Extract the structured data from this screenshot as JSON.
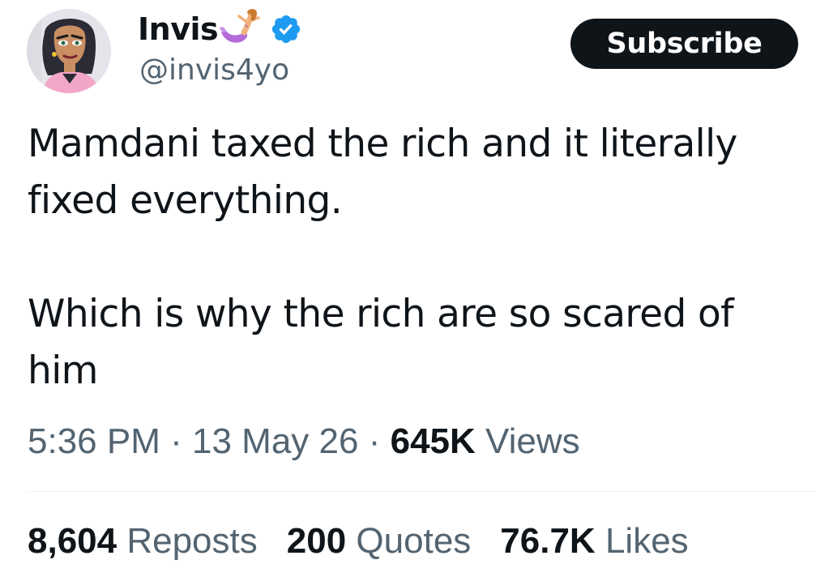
{
  "author": {
    "display_name": "Invis",
    "handle": "@invis4yo",
    "name_emoji": "mermaid-emoji",
    "verified_icon": "verified-badge-icon",
    "verified_color": "#1d9bf0"
  },
  "subscribe_button": {
    "label": "Subscribe",
    "bg_color": "#0f1419",
    "text_color": "#ffffff"
  },
  "tweet": {
    "paragraphs": [
      "Mamdani taxed the rich and it literally fixed everything.",
      "Which is why the rich are so scared of him"
    ]
  },
  "meta": {
    "time": "5:36 PM",
    "separator": "·",
    "date": "13 May 26",
    "views_count": "645K",
    "views_label": "Views"
  },
  "stats": {
    "reposts_count": "8,604",
    "reposts_label": "Reposts",
    "quotes_count": "200",
    "quotes_label": "Quotes",
    "likes_count": "76.7K",
    "likes_label": "Likes"
  },
  "colors": {
    "text_primary": "#0f1419",
    "text_secondary": "#536471",
    "divider": "#eff3f4"
  }
}
